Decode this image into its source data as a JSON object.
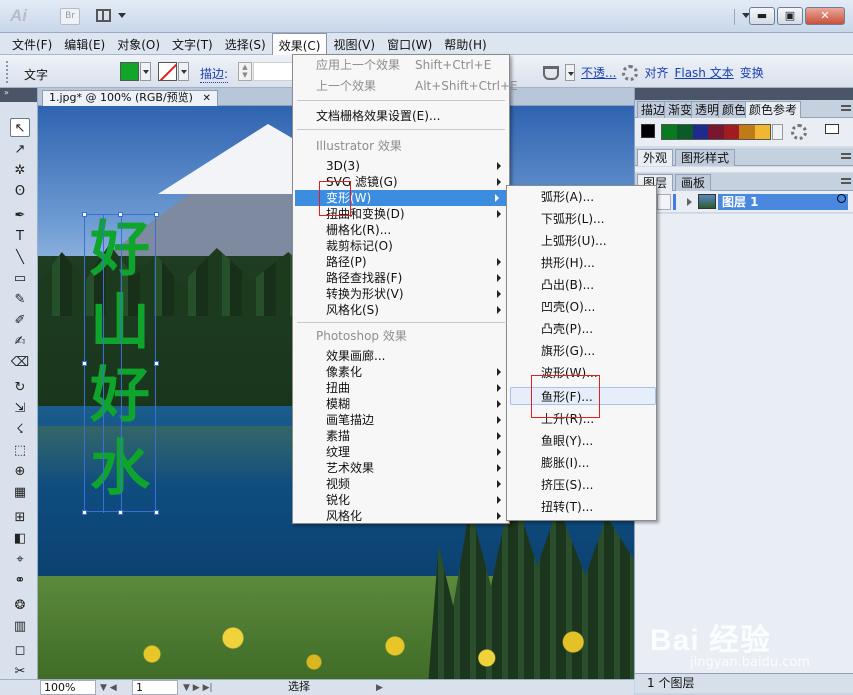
{
  "app": {
    "logo": "Ai",
    "bridge": "Br"
  },
  "window_controls": {
    "minimize": "▬",
    "restore": "▣",
    "close": "✕"
  },
  "menubar": [
    {
      "label": "文件(F)"
    },
    {
      "label": "编辑(E)"
    },
    {
      "label": "对象(O)"
    },
    {
      "label": "文字(T)"
    },
    {
      "label": "选择(S)"
    },
    {
      "label": "效果(C)"
    },
    {
      "label": "视图(V)"
    },
    {
      "label": "窗口(W)"
    },
    {
      "label": "帮助(H)"
    }
  ],
  "controlbar": {
    "tool_label": "文字",
    "fill_color": "#11a52a",
    "stroke_label": "描边:",
    "opacity_label": "不透...",
    "align_label": "对齐",
    "flash_label": "Flash 文本",
    "transform_label": "变换"
  },
  "document": {
    "tab_title": "1.jpg* @ 100% (RGB/预览)",
    "close": "✕"
  },
  "canvas": {
    "text_chars": [
      "好",
      "山",
      "好",
      "水"
    ],
    "text_color": "#0fa52c"
  },
  "effect_menu": {
    "apply_last": "应用上一个效果",
    "apply_last_shortcut": "Shift+Ctrl+E",
    "last_effect": "上一个效果",
    "last_effect_shortcut": "Alt+Shift+Ctrl+E",
    "raster_settings": "文档栅格效果设置(E)...",
    "illustrator_header": "Illustrator 效果",
    "illustrator_items": [
      "3D(3)",
      "SVG 滤镜(G)",
      "变形(W)",
      "扭曲和变换(D)",
      "栅格化(R)...",
      "裁剪标记(O)",
      "路径(P)",
      "路径查找器(F)",
      "转换为形状(V)",
      "风格化(S)"
    ],
    "photoshop_header": "Photoshop 效果",
    "photoshop_items": [
      "效果画廊...",
      "像素化",
      "扭曲",
      "模糊",
      "画笔描边",
      "素描",
      "纹理",
      "艺术效果",
      "视频",
      "锐化",
      "风格化"
    ]
  },
  "warp_submenu": [
    "弧形(A)...",
    "下弧形(L)...",
    "上弧形(U)...",
    "拱形(H)...",
    "凸出(B)...",
    "凹壳(O)...",
    "凸壳(P)...",
    "旗形(G)...",
    "波形(W)...",
    "鱼形(F)...",
    "上升(R)...",
    "鱼眼(Y)...",
    "膨胀(I)...",
    "挤压(S)...",
    "扭转(T)..."
  ],
  "right_panels": {
    "top_tabs": [
      "描边",
      "渐变",
      "透明",
      "颜色",
      "颜色参考"
    ],
    "color_guide_swatches": [
      "#0a7a20",
      "#0a5a2a",
      "#1e2a8c",
      "#7a1630",
      "#a01c20",
      "#c07a18",
      "#f0b830"
    ],
    "appearance_tabs": [
      "外观",
      "图形样式"
    ],
    "layers_tabs": [
      "图层",
      "画板"
    ],
    "layer_name": "图层 1",
    "layers_footer": "1 个图层"
  },
  "statusbar": {
    "zoom": "100%",
    "page": "1",
    "status": "选择"
  },
  "watermark": {
    "main": "Bai 经验",
    "sub": "jingyan.baidu.com"
  }
}
